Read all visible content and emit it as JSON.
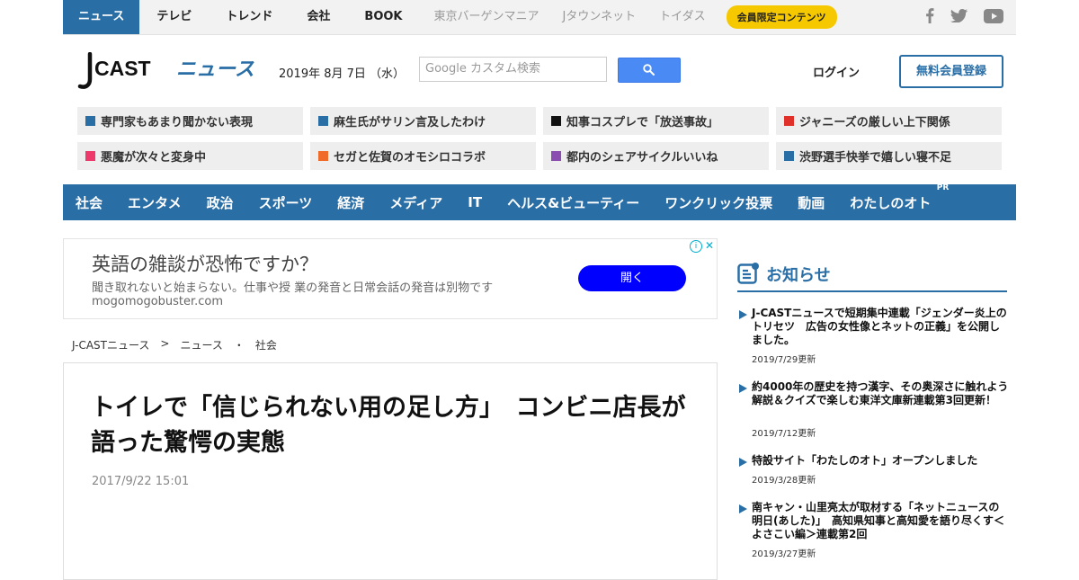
{
  "topbar": {
    "tabs": [
      {
        "label": "ニュース",
        "active": true
      },
      {
        "label": "テレビ"
      },
      {
        "label": "トレンド"
      },
      {
        "label": "会社"
      },
      {
        "label": "BOOK"
      }
    ],
    "grey_links": [
      "東京バーゲンマニア",
      "Jタウンネット",
      "トイダス"
    ],
    "member_badge": "会員限定コンテンツ",
    "social_icons": [
      "facebook-icon",
      "twitter-icon",
      "youtube-icon"
    ]
  },
  "header": {
    "logo_j": "J",
    "logo_cast": "CAST",
    "logo_news": "ニュース",
    "date": "2019年 8月 7日 （水）",
    "search_placeholder": "Google カスタム検索",
    "login": "ログイン",
    "register": "無料会員登録"
  },
  "topics": [
    {
      "label": "専門家もあまり聞かない表現",
      "color": "#2a6ea6"
    },
    {
      "label": "麻生氏がサリン言及したわけ",
      "color": "#2a6ea6"
    },
    {
      "label": "知事コスプレで「放送事故」",
      "color": "#111111"
    },
    {
      "label": "ジャニーズの厳しい上下関係",
      "color": "#e0302a"
    },
    {
      "label": "悪魔が次々と変身中",
      "color": "#ee3a6a"
    },
    {
      "label": "セガと佐賀のオモシロコラボ",
      "color": "#f06a2a"
    },
    {
      "label": "都内のシェアサイクルいいね",
      "color": "#8a4db0"
    },
    {
      "label": "渋野選手快挙で嬉しい寝不足",
      "color": "#2a6ea6"
    }
  ],
  "categories": [
    "社会",
    "エンタメ",
    "政治",
    "スポーツ",
    "経済",
    "メディア",
    "IT",
    "ヘルス&ビューティー",
    "ワンクリック投票",
    "動画",
    "わたしのオト"
  ],
  "pr_label": "PR",
  "ad": {
    "headline": "英語の雑談が恐怖ですか？",
    "description": "聞き取れないと始まらない。仕事や授 業の発音と日常会話の発音は別物です",
    "url": "mogomogobuster.com",
    "button": "開く",
    "info_icon": "i",
    "close_icon": "✕"
  },
  "breadcrumb": {
    "items": [
      "J-CASTニュース",
      "ニュース",
      "社会"
    ],
    "separators": [
      ">",
      "・"
    ]
  },
  "article": {
    "title": "トイレで「信じられない用の足し方」　コンビニ店長が語った驚愕の実態",
    "time": "2017/9/22 15:01"
  },
  "sidebar": {
    "title": "お知らせ",
    "notices": [
      {
        "text": "J-CASTニュースで短期集中連載「ジェンダー炎上のトリセツ　広告の女性像とネットの正義」を公開しました。",
        "date": "2019/7/29更新"
      },
      {
        "text": "約4000年の歴史を持つ漢字、その奥深さに触れよう　解説＆クイズで楽しむ東洋文庫新連載第3回更新！",
        "date": "2019/7/12更新"
      },
      {
        "text": "特設サイト「わたしのオト」オープンしました",
        "date": "2019/3/28更新"
      },
      {
        "text": "南キャン・山里亮太が取材する「ネットニュースの明日(あした)」　高知県知事と高知愛を語り尽くす＜よさこい編＞連載第2回",
        "date": "2019/3/27更新"
      }
    ]
  },
  "colors": {
    "brand": "#2a6ea6",
    "member_badge": "#f6c800",
    "ad_button": "#0000ff"
  }
}
